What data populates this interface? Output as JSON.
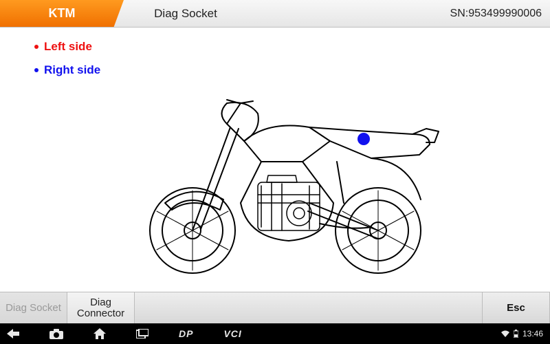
{
  "header": {
    "brand": "KTM",
    "title": "Diag Socket",
    "serial": "SN:953499990006"
  },
  "legend": {
    "left": "Left side",
    "right": "Right side"
  },
  "diagram": {
    "marker_color": "blue",
    "marker_side": "right"
  },
  "bottom": {
    "socket": "Diag Socket",
    "connector": "Diag Connector",
    "esc": "Esc"
  },
  "navbar": {
    "dp": "DP",
    "vci": "VCI",
    "time": "13:46"
  }
}
